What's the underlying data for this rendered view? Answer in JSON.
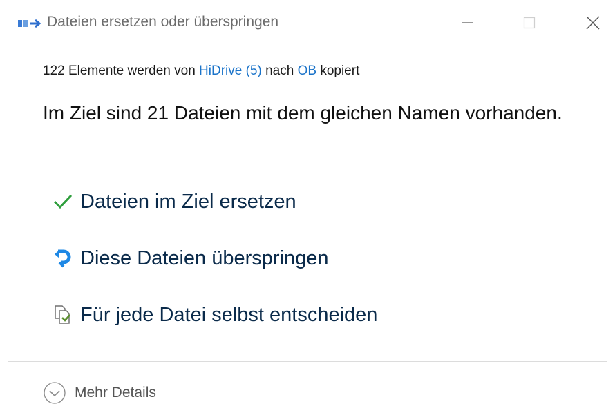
{
  "window": {
    "title": "Dateien ersetzen oder überspringen",
    "controls": {
      "minimize_icon": "minimize-icon",
      "maximize_icon": "maximize-icon",
      "close_icon": "close-icon"
    }
  },
  "summary": {
    "prefix": "122 Elemente werden von ",
    "source": "HiDrive (5)",
    "middle": " nach ",
    "destination": "OB",
    "suffix": " kopiert"
  },
  "headline": "Im Ziel sind 21 Dateien mit dem gleichen Namen vorhanden.",
  "options": [
    {
      "label": "Dateien im Ziel ersetzen",
      "icon": "checkmark-icon",
      "color": "#2e9e3c"
    },
    {
      "label": "Diese Dateien überspringen",
      "icon": "skip-arrow-icon",
      "color": "#1e88e5"
    },
    {
      "label": "Für jede Datei selbst entscheiden",
      "icon": "compare-files-icon",
      "color": "#5a8f2e"
    }
  ],
  "footer": {
    "details_label": "Mehr Details",
    "details_icon": "chevron-down-circle-icon"
  },
  "colors": {
    "link": "#1a73c9",
    "option_text": "#0a2a4a",
    "title_text": "#6b6b6b"
  }
}
